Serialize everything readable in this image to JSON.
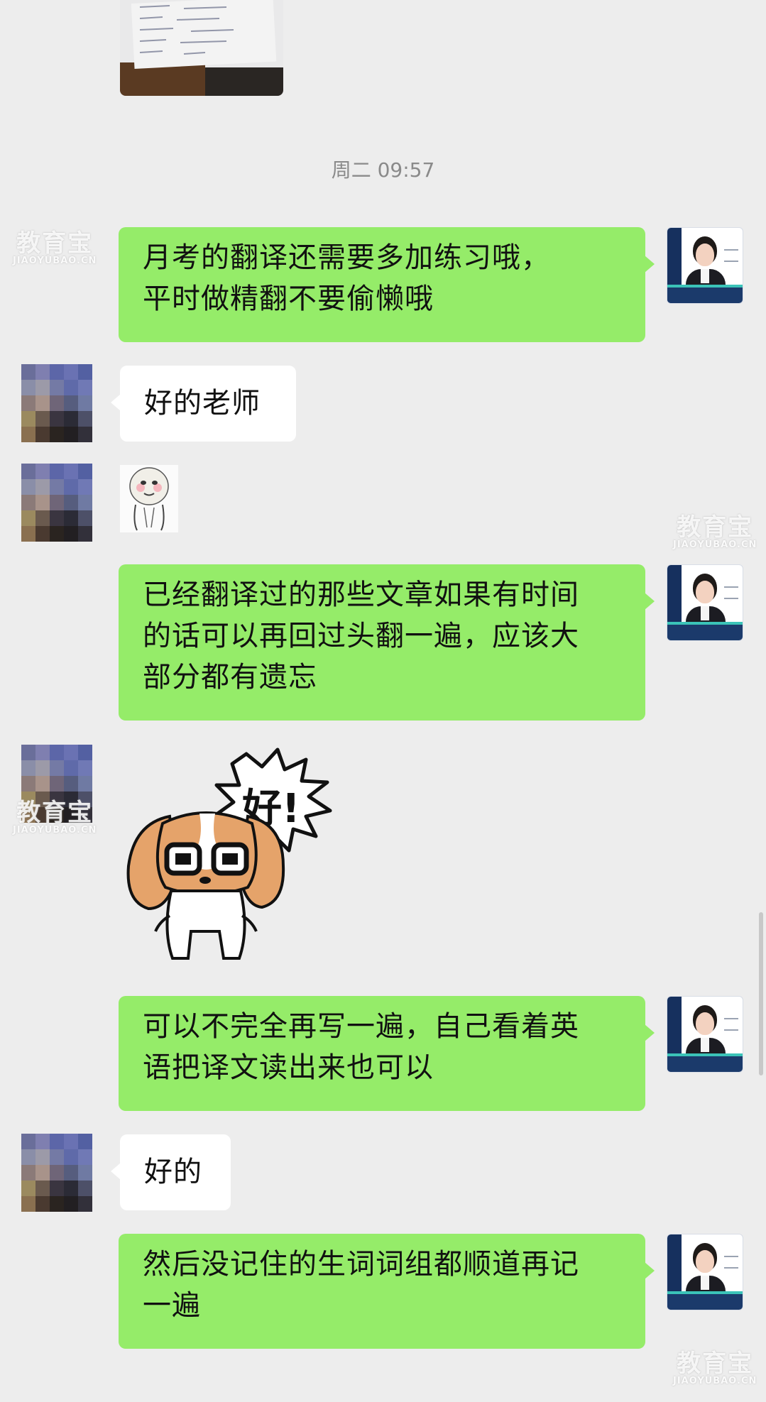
{
  "chat": {
    "timestamp": "周二 09:57",
    "messages": [
      {
        "sender": "teacher",
        "type": "text",
        "text": "月考的翻译还需要多加练习哦，\n平时做精翻不要偷懒哦"
      },
      {
        "sender": "student",
        "type": "text",
        "text": "好的老师"
      },
      {
        "sender": "student",
        "type": "sticker",
        "sticker": "shy-meme-sticker"
      },
      {
        "sender": "teacher",
        "type": "text",
        "text": "已经翻译过的那些文章如果有时间\n的话可以再回过头翻一遍，应该大\n部分都有遗忘"
      },
      {
        "sender": "student",
        "type": "sticker",
        "sticker": "dog-ok-sticker",
        "sticker_text": "好!"
      },
      {
        "sender": "teacher",
        "type": "text",
        "text": "可以不完全再写一遍，自己看着英\n语把译文读出来也可以"
      },
      {
        "sender": "student",
        "type": "text",
        "text": "好的"
      },
      {
        "sender": "teacher",
        "type": "text",
        "text": "然后没记住的生词词组都顺道再记\n一遍"
      }
    ]
  },
  "watermark": {
    "brand_cn": "教育宝",
    "brand_en": "JIAOYUBAO.CN"
  },
  "colors": {
    "background": "#ededed",
    "my_bubble": "#95ec69",
    "their_bubble": "#ffffff",
    "timestamp": "#8a8a8a"
  }
}
